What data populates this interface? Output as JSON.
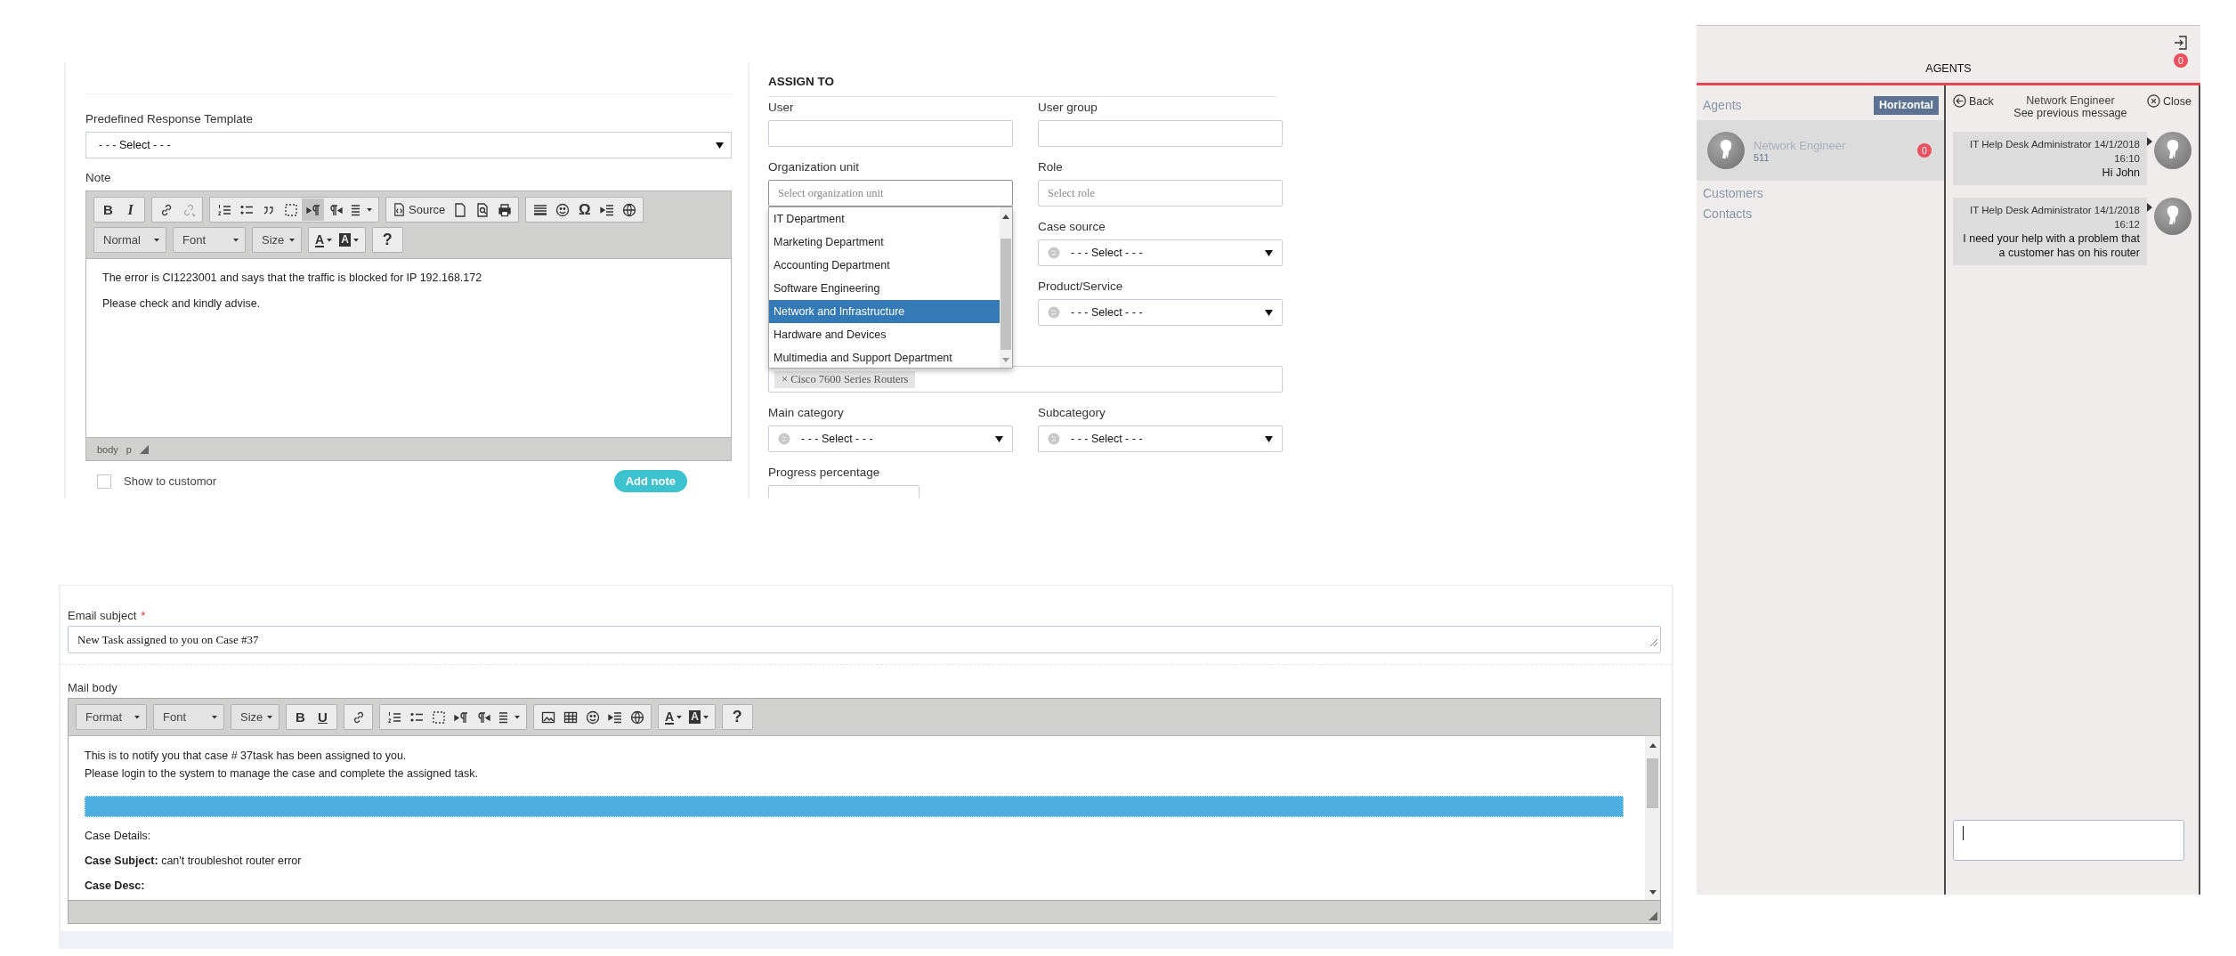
{
  "note_panel": {
    "template": {
      "label": "Predefined Response Template",
      "value": "- - - Select - - -"
    },
    "note": {
      "label": "Note",
      "toolbar_rows": [
        [
          [
            {
              "kind": "bold",
              "label": "B",
              "on": false
            },
            {
              "kind": "italic",
              "label": "I",
              "on": false
            }
          ],
          [
            {
              "kind": "icon",
              "on": false
            },
            {
              "kind": "icon",
              "on": false
            }
          ],
          [
            {
              "kind": "icon",
              "on": false
            },
            {
              "kind": "icon",
              "on": false
            },
            {
              "kind": "icon",
              "on": false
            },
            {
              "kind": "icon",
              "on": false
            },
            {
              "kind": "icon",
              "on": true
            },
            {
              "kind": "icon",
              "on": false
            },
            {
              "kind": "menu",
              "on": false
            }
          ],
          [
            {
              "kind": "source",
              "label": "Source",
              "on": false
            },
            {
              "kind": "icon",
              "on": false
            },
            {
              "kind": "icon",
              "on": false
            },
            {
              "kind": "icon",
              "on": false
            }
          ],
          [
            {
              "kind": "icon",
              "on": false
            },
            {
              "kind": "icon",
              "on": false
            },
            {
              "kind": "symbol",
              "label": "Ω",
              "on": false
            },
            {
              "kind": "icon",
              "on": false
            },
            {
              "kind": "icon",
              "on": false
            }
          ]
        ],
        [
          [
            {
              "kind": "combo",
              "label": "Normal",
              "on": false
            }
          ],
          [
            {
              "kind": "combo",
              "label": "Font",
              "on": false
            }
          ],
          [
            {
              "kind": "combo",
              "label": "Size",
              "on": false
            }
          ],
          [
            {
              "kind": "color",
              "label": "A",
              "on": false
            },
            {
              "kind": "bgcolor",
              "label": "A",
              "on": false
            }
          ],
          [
            {
              "kind": "help",
              "label": "?",
              "on": false
            }
          ]
        ]
      ],
      "paragraphs": [
        "The error is CI1223001 and says that the traffic is blocked for IP 192.168.172",
        "Please check and kindly advise."
      ],
      "status_path": [
        "body",
        "p"
      ]
    },
    "show_to_customer": {
      "label": "Show to customor",
      "checked": false
    },
    "add_note": "Add note"
  },
  "assign_panel": {
    "title": "ASSIGN TO",
    "fields": [
      {
        "kind": "text",
        "label": "User"
      },
      {
        "kind": "text",
        "label": "User group"
      },
      {
        "kind": "picker",
        "label": "Organization unit",
        "placeholder": "Select organization unit",
        "expanded": true,
        "options": [
          {
            "label": "IT Department",
            "selected": false
          },
          {
            "label": "Marketing Department",
            "selected": false
          },
          {
            "label": "Accounting Department",
            "selected": false
          },
          {
            "label": "Software Engineering",
            "selected": false
          },
          {
            "label": "Network and Infrastructure",
            "selected": true
          },
          {
            "label": "Hardware and Devices",
            "selected": false
          },
          {
            "label": "Multimedia and Support Department",
            "selected": false
          }
        ]
      },
      {
        "kind": "picker",
        "label": "Role",
        "placeholder": "Select role",
        "expanded": false
      },
      {
        "kind": "combo",
        "label": "Case source",
        "value": "- - - Select - - -"
      },
      {
        "kind": "combo",
        "label": "Product/Service",
        "value": "- - - Select - - -"
      },
      {
        "kind": "tags",
        "tags": [
          {
            "label": "Cisco 7600 Series Routers",
            "remove": "×"
          }
        ]
      },
      {
        "kind": "combo",
        "label": "Main category",
        "value": "- - - Select - - -"
      },
      {
        "kind": "combo",
        "label": "Subcategory",
        "value": "- - - Select - - -"
      },
      {
        "kind": "progress",
        "label": "Progress percentage"
      }
    ]
  },
  "email_panel": {
    "subject": {
      "label": "Email subject",
      "required_mark": "*",
      "value": "New Task assigned to you on Case #37"
    },
    "body": {
      "label": "Mail body",
      "toolbar_rows": [
        [
          [
            {
              "kind": "combo",
              "label": "Format"
            }
          ],
          [
            {
              "kind": "combo",
              "label": "Font"
            }
          ],
          [
            {
              "kind": "combo",
              "label": "Size"
            }
          ],
          [
            {
              "kind": "bold",
              "label": "B"
            },
            {
              "kind": "underline",
              "label": "U"
            }
          ],
          [
            {
              "kind": "icon"
            }
          ],
          [
            {
              "kind": "icon"
            },
            {
              "kind": "icon"
            },
            {
              "kind": "icon"
            },
            {
              "kind": "icon"
            },
            {
              "kind": "icon"
            },
            {
              "kind": "menu"
            }
          ],
          [
            {
              "kind": "icon"
            },
            {
              "kind": "icon"
            },
            {
              "kind": "icon"
            },
            {
              "kind": "icon"
            },
            {
              "kind": "icon"
            }
          ],
          [
            {
              "kind": "color",
              "label": "A"
            },
            {
              "kind": "bgcolor",
              "label": "A"
            }
          ],
          [
            {
              "kind": "help",
              "label": "?"
            }
          ]
        ]
      ],
      "paragraphs": [
        {
          "kind": "line",
          "text": "This is to notify you that case # 37task has been assigned to you."
        },
        {
          "kind": "line",
          "text": "Please login to the system to manage the case and complete the assigned task."
        },
        {
          "kind": "banner"
        },
        {
          "kind": "para",
          "text": "Case Details:"
        },
        {
          "kind": "para",
          "text": "**Case Subject:** can't troubleshot router error"
        },
        {
          "kind": "para",
          "text": "**Case Desc:**"
        }
      ]
    }
  },
  "chat_panel": {
    "unread": "0",
    "title": "AGENTS",
    "agents_heading": "Agents",
    "layout_button": "Horizontal",
    "agents": [
      {
        "name": "Network Engineer",
        "extension": "511",
        "unread": "0",
        "selected": true
      }
    ],
    "sections": [
      "Customers",
      "Contacts"
    ],
    "conversation": {
      "back": "Back",
      "title": "Network Engineer",
      "subtitle": "See previous message",
      "close": "Close",
      "messages": [
        {
          "meta": "IT Help Desk Administrator 14/1/2018",
          "time": "16:10",
          "text": "Hi John"
        },
        {
          "meta": "IT Help Desk Administrator 14/1/2018",
          "time": "16:12",
          "text": "I need your help with a problem that a customer has on his router"
        }
      ]
    }
  }
}
